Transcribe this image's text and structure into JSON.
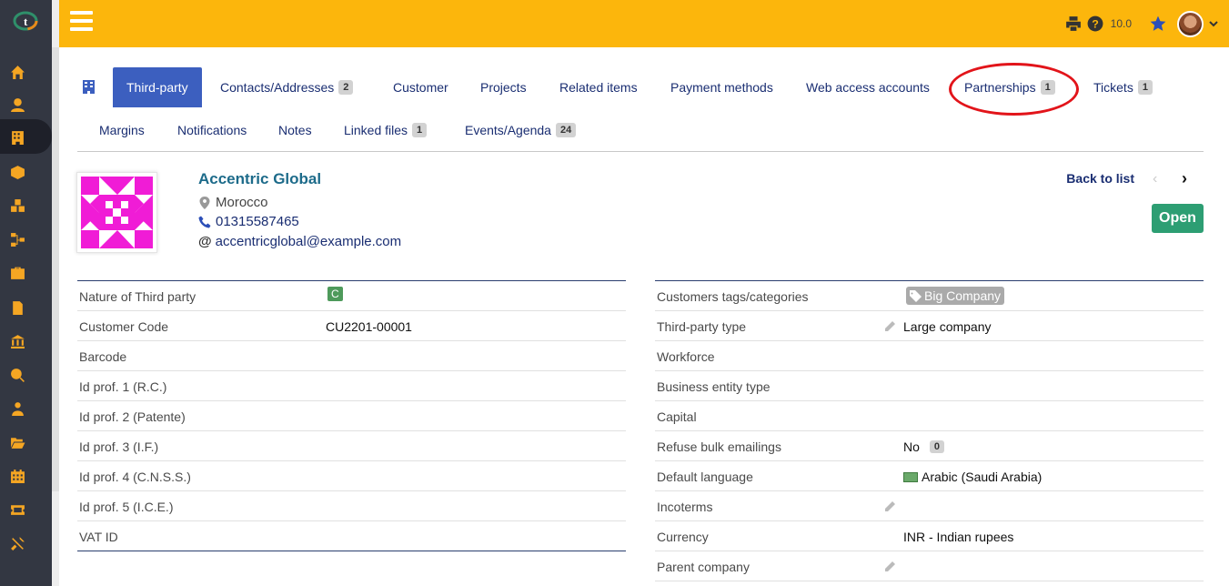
{
  "topbar": {
    "version": "10.0"
  },
  "tabs": {
    "row1": [
      {
        "label": "Third-party",
        "badge": ""
      },
      {
        "label": "Contacts/Addresses",
        "badge": "2"
      },
      {
        "label": "Customer",
        "badge": ""
      },
      {
        "label": "Projects",
        "badge": ""
      },
      {
        "label": "Related items",
        "badge": ""
      },
      {
        "label": "Payment methods",
        "badge": ""
      },
      {
        "label": "Web access accounts",
        "badge": ""
      },
      {
        "label": "Partnerships",
        "badge": "1"
      },
      {
        "label": "Tickets",
        "badge": "1"
      }
    ],
    "row2": [
      {
        "label": "Margins",
        "badge": ""
      },
      {
        "label": "Notifications",
        "badge": ""
      },
      {
        "label": "Notes",
        "badge": ""
      },
      {
        "label": "Linked files",
        "badge": "1"
      },
      {
        "label": "Events/Agenda",
        "badge": "24"
      }
    ]
  },
  "company": {
    "name": "Accentric Global",
    "country": "Morocco",
    "phone": "01315587465",
    "email": "accentricglobal@example.com"
  },
  "actions": {
    "back_to_list": "Back to list",
    "open": "Open"
  },
  "left_fields": [
    {
      "label": "Nature of Third party",
      "value": "C"
    },
    {
      "label": "Customer Code",
      "value": "CU2201-00001"
    },
    {
      "label": "Barcode",
      "value": ""
    },
    {
      "label": "Id prof. 1 (R.C.)",
      "value": ""
    },
    {
      "label": "Id prof. 2 (Patente)",
      "value": ""
    },
    {
      "label": "Id prof. 3 (I.F.)",
      "value": ""
    },
    {
      "label": "Id prof. 4 (C.N.S.S.)",
      "value": ""
    },
    {
      "label": "Id prof. 5 (I.C.E.)",
      "value": ""
    },
    {
      "label": "VAT ID",
      "value": ""
    }
  ],
  "right_fields": [
    {
      "label": "Customers tags/categories",
      "value": "Big Company"
    },
    {
      "label": "Third-party type",
      "value": "Large company"
    },
    {
      "label": "Workforce",
      "value": ""
    },
    {
      "label": "Business entity type",
      "value": ""
    },
    {
      "label": "Capital",
      "value": ""
    },
    {
      "label": "Refuse bulk emailings",
      "value": "No",
      "badge": "0"
    },
    {
      "label": "Default language",
      "value": "Arabic (Saudi Arabia)"
    },
    {
      "label": "Incoterms",
      "value": ""
    },
    {
      "label": "Currency",
      "value": "INR - Indian rupees"
    },
    {
      "label": "Parent company",
      "value": ""
    }
  ],
  "colors": {
    "topbar": "#fcb60c",
    "sidebar": "#333742",
    "active_tab": "#3c5fbf",
    "open_button": "#2d9e73",
    "highlight_ring": "#e2141a"
  }
}
